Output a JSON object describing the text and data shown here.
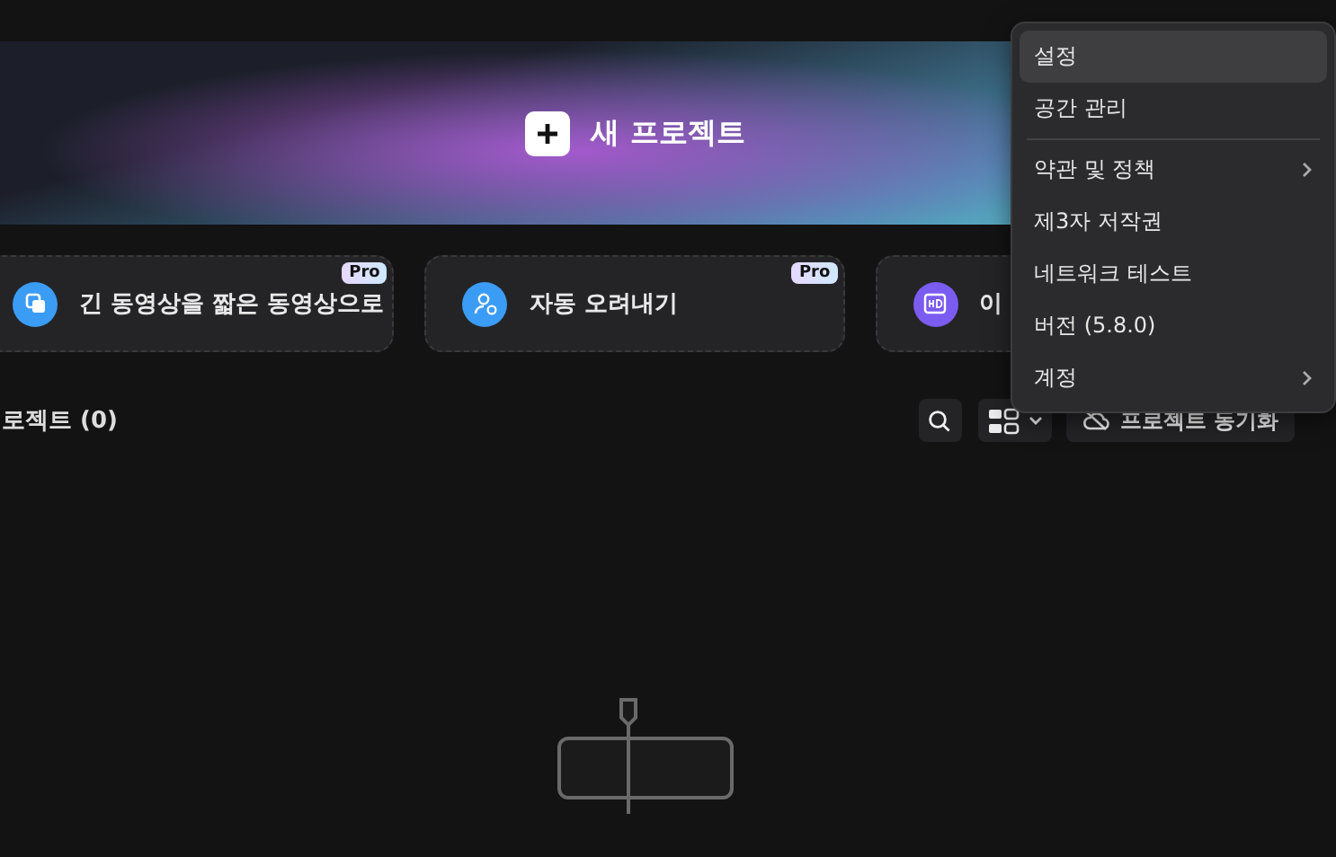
{
  "banner": {
    "label": "새 프로젝트"
  },
  "feature_cards": [
    {
      "kind": "clips",
      "label": "긴 동영상을 짧은 동영상으로",
      "badge": "Pro",
      "color": "#3b9cf5"
    },
    {
      "kind": "person",
      "label": "자동 오려내기",
      "badge": "Pro",
      "color": "#3b9cf5"
    },
    {
      "kind": "hd",
      "label": "이",
      "color": "#7b5cf0"
    }
  ],
  "projects": {
    "title": "로젝트 (0)",
    "sync_button": "프로젝트 동기화"
  },
  "menu": {
    "items": [
      {
        "kind": "item",
        "label": "설정",
        "selected": true,
        "submenu": false
      },
      {
        "kind": "item",
        "label": "공간 관리",
        "selected": false,
        "submenu": false
      },
      {
        "kind": "separator"
      },
      {
        "kind": "item",
        "label": "약관 및 정책",
        "selected": false,
        "submenu": true
      },
      {
        "kind": "item",
        "label": "제3자 저작권",
        "selected": false,
        "submenu": false
      },
      {
        "kind": "item",
        "label": "네트워크 테스트",
        "selected": false,
        "submenu": false
      },
      {
        "kind": "item",
        "label": "버전 (5.8.0)",
        "selected": false,
        "submenu": false
      },
      {
        "kind": "item",
        "label": "계정",
        "selected": false,
        "submenu": true
      }
    ]
  }
}
